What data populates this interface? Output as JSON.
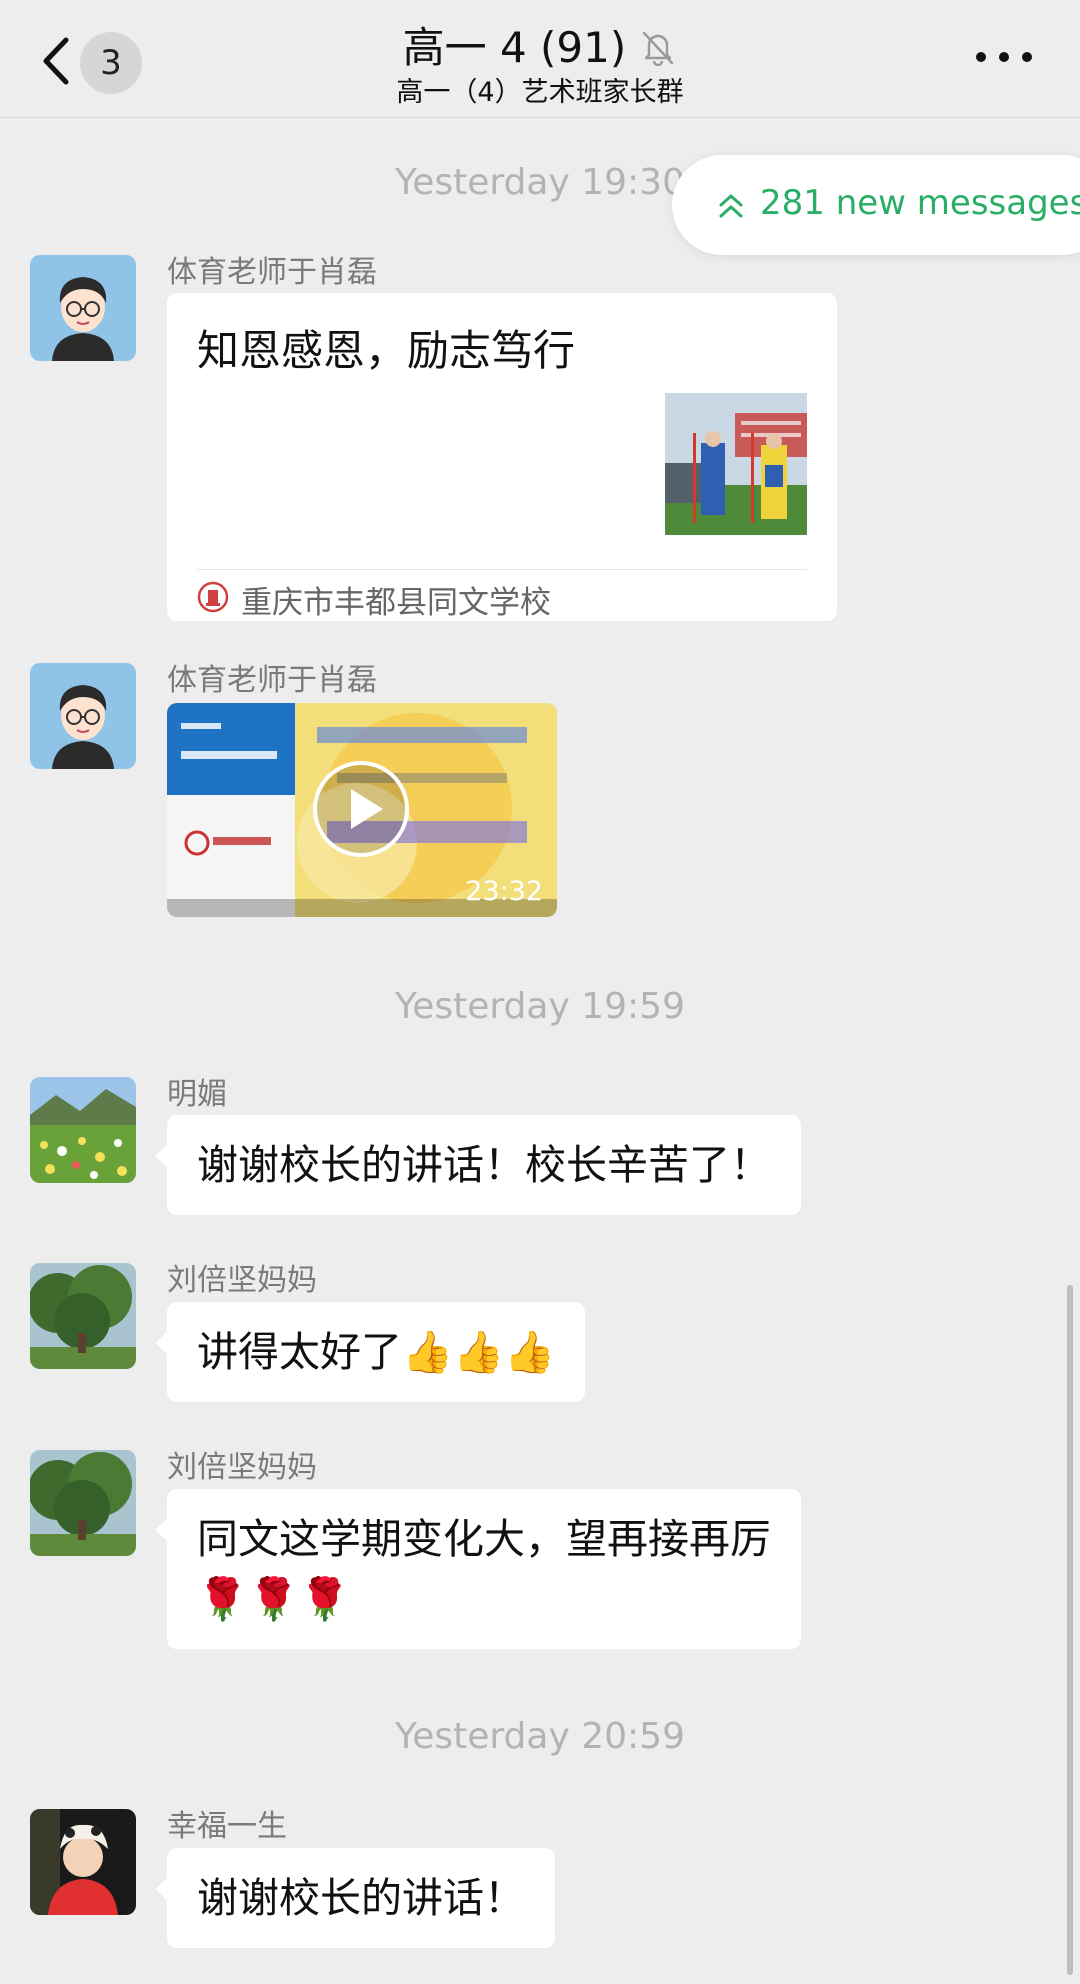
{
  "header": {
    "back_count": "3",
    "title": "高一 4 (91)",
    "subtitle": "高一（4）艺术班家长群"
  },
  "new_messages": {
    "label": "281 new messages",
    "color": "#2aae67"
  },
  "timestamps": [
    "Yesterday 19:30",
    "Yesterday 19:59",
    "Yesterday 20:59"
  ],
  "messages": [
    {
      "sender": "体育老师于肖磊",
      "type": "link",
      "title": "知恩感恩，励志笃行",
      "source": "重庆市丰都县同文学校"
    },
    {
      "sender": "体育老师于肖磊",
      "type": "video",
      "duration": "23:32"
    },
    {
      "sender": "明媚",
      "type": "text",
      "text": "谢谢校长的讲话！校长辛苦了！"
    },
    {
      "sender": "刘倍坚妈妈",
      "type": "text",
      "text": "讲得太好了👍👍👍"
    },
    {
      "sender": "刘倍坚妈妈",
      "type": "text",
      "line1": "同文这学期变化大，望再接再厉",
      "line2": "🌹🌹🌹"
    },
    {
      "sender": "幸福一生",
      "type": "text",
      "text": "谢谢校长的讲话！"
    }
  ],
  "icons": {
    "back": "chevron-left-icon",
    "mute": "bell-muted-icon",
    "more": "more-dots-icon",
    "new_messages": "double-chevron-up-icon",
    "play": "play-icon"
  }
}
